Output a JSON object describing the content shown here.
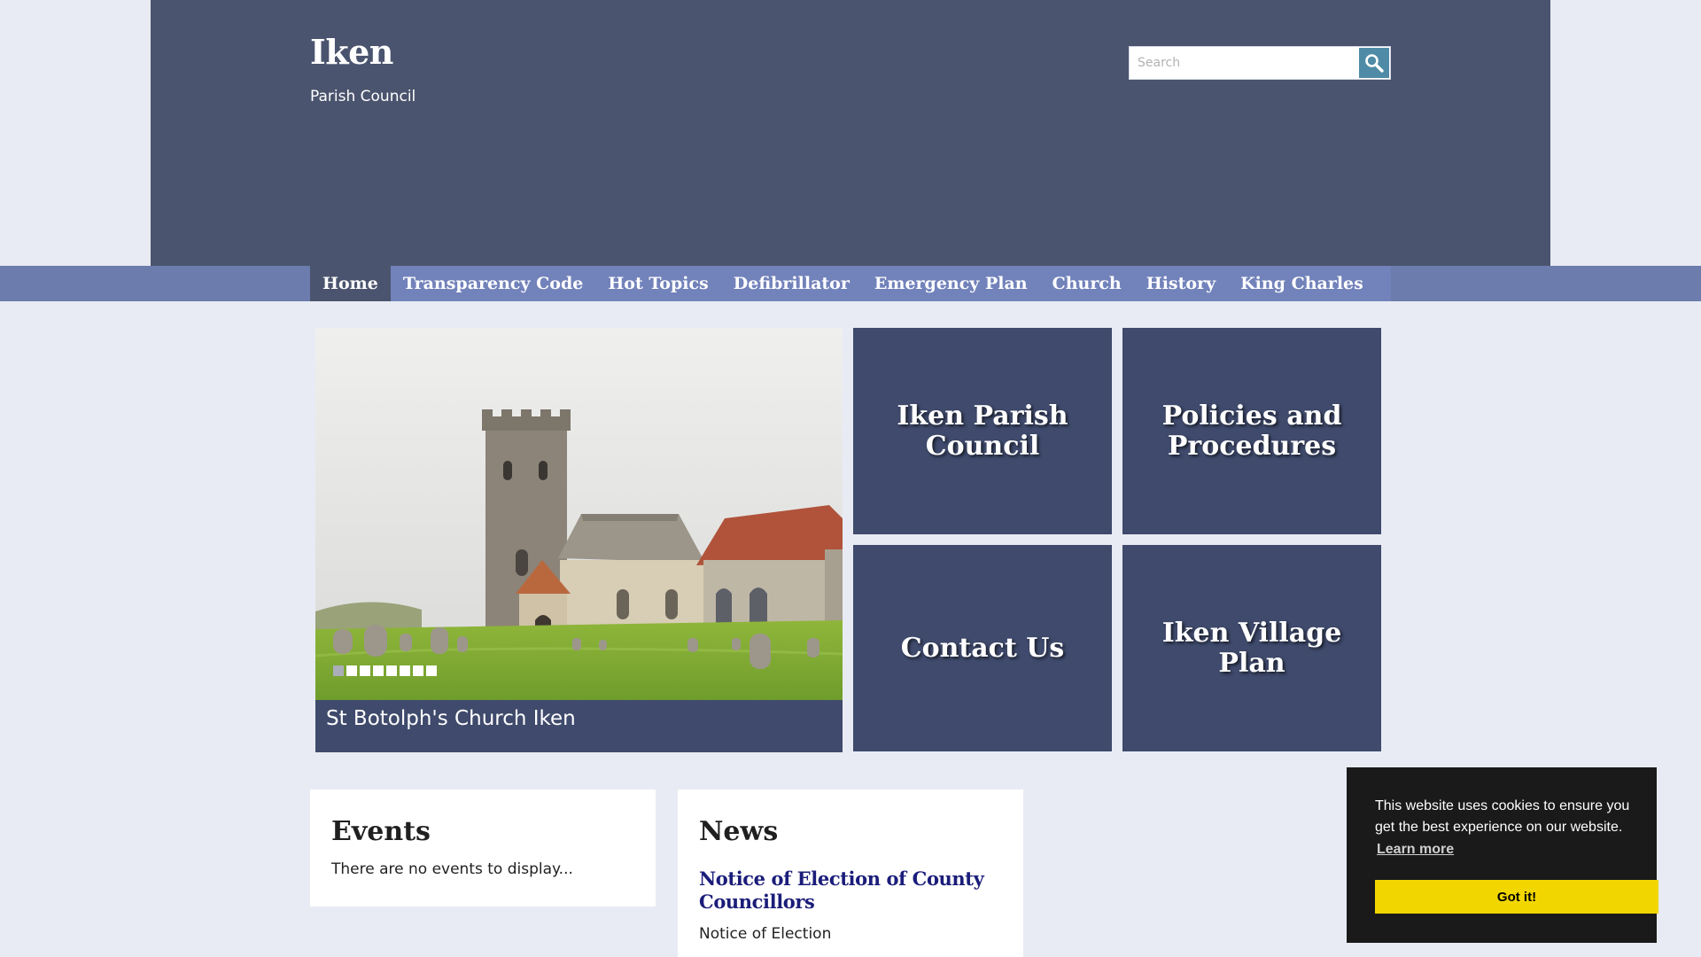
{
  "header": {
    "site_title": "Iken",
    "site_subtitle": "Parish Council",
    "search_placeholder": "Search",
    "search_icon": "magnifier-icon"
  },
  "nav": {
    "items": [
      {
        "label": "Home",
        "active": true
      },
      {
        "label": "Transparency Code",
        "active": false
      },
      {
        "label": "Hot Topics",
        "active": false
      },
      {
        "label": "Defibrillator",
        "active": false
      },
      {
        "label": "Emergency Plan",
        "active": false
      },
      {
        "label": "Church",
        "active": false
      },
      {
        "label": "History",
        "active": false
      },
      {
        "label": "King Charles",
        "active": false
      }
    ]
  },
  "slideshow": {
    "caption": "St Botolph's Church Iken",
    "slide_count": 8,
    "active_slide": 1
  },
  "tiles": [
    {
      "label": "Iken Parish Council"
    },
    {
      "label": "Policies and Procedures"
    },
    {
      "label": "Contact Us"
    },
    {
      "label": "Iken Village Plan"
    }
  ],
  "events": {
    "heading": "Events",
    "empty_text": "There are no events to display..."
  },
  "news": {
    "heading": "News",
    "items": [
      {
        "title": "Notice of Election of County Councillors",
        "summary": "Notice of Election"
      }
    ]
  },
  "cookie_banner": {
    "message": "This website uses cookies to ensure you get the best experience on our website.",
    "learn_more": "Learn more",
    "accept": "Got it!"
  },
  "colors": {
    "header_bg": "#4b546e",
    "nav_bg": "#7282ba",
    "tile_bg": "#3f4a6c",
    "page_bg": "#e8ebf3",
    "news_link": "#1b1d7a",
    "cookie_button": "#f1d600"
  }
}
